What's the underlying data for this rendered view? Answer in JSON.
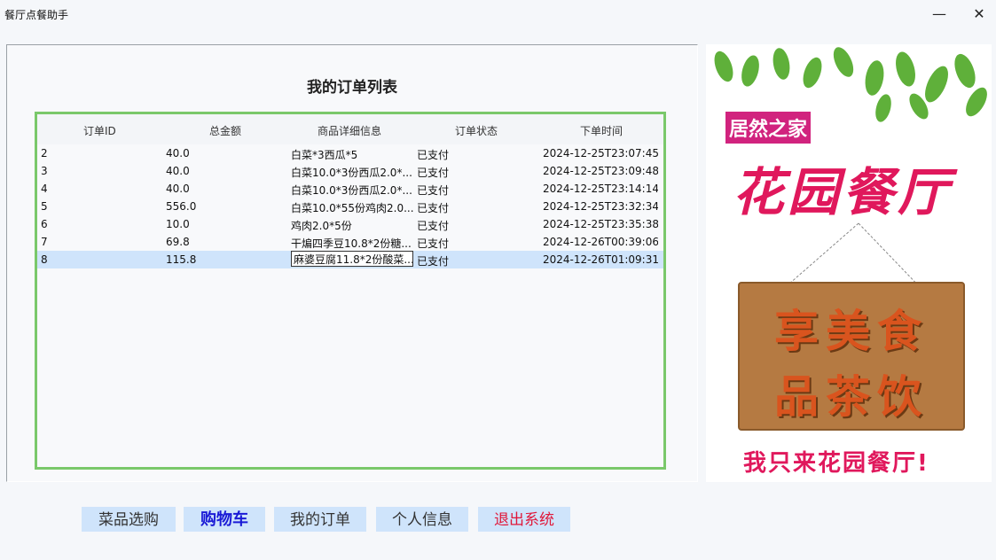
{
  "window": {
    "title": "餐厅点餐助手",
    "minimize_glyph": "—",
    "close_glyph": "✕"
  },
  "panel": {
    "title": "我的订单列表"
  },
  "table": {
    "columns": [
      "订单ID",
      "总金额",
      "商品详细信息",
      "订单状态",
      "下单时间"
    ],
    "rows": [
      {
        "id": "2",
        "amount": "40.0",
        "details": "白菜*3西瓜*5",
        "status": "已支付",
        "time": "2024-12-25T23:07:45"
      },
      {
        "id": "3",
        "amount": "40.0",
        "details": "白菜10.0*3份西瓜2.0*...",
        "status": "已支付",
        "time": "2024-12-25T23:09:48"
      },
      {
        "id": "4",
        "amount": "40.0",
        "details": "白菜10.0*3份西瓜2.0*...",
        "status": "已支付",
        "time": "2024-12-25T23:14:14"
      },
      {
        "id": "5",
        "amount": "556.0",
        "details": "白菜10.0*55份鸡肉2.0...",
        "status": "已支付",
        "time": "2024-12-25T23:32:34"
      },
      {
        "id": "6",
        "amount": "10.0",
        "details": "鸡肉2.0*5份",
        "status": "已支付",
        "time": "2024-12-25T23:35:38"
      },
      {
        "id": "7",
        "amount": "69.8",
        "details": "干煸四季豆10.8*2份糖...",
        "status": "已支付",
        "time": "2024-12-26T00:39:06"
      },
      {
        "id": "8",
        "amount": "115.8",
        "details": "麻婆豆腐11.8*2份酸菜...",
        "status": "已支付",
        "time": "2024-12-26T01:09:31",
        "selected": true
      }
    ]
  },
  "ad": {
    "brand": "居然之家",
    "name": "花园餐厅",
    "sign_line1": "享美食",
    "sign_line2": "品茶饮",
    "slogan": "我只来花园餐厅!"
  },
  "nav": {
    "browse": "菜品选购",
    "cart": "购物车",
    "orders": "我的订单",
    "profile": "个人信息",
    "logout": "退出系统"
  },
  "colors": {
    "accent_green": "#7ac86a",
    "selected_row": "#cfe4fb",
    "logout_red": "#e0183a",
    "cart_blue": "#1a1ad6"
  }
}
